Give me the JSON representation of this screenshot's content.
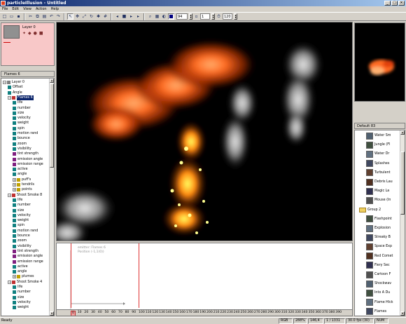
{
  "window": {
    "title": "particleIllusion - Untitled",
    "buttons": [
      "_",
      "□",
      "×"
    ]
  },
  "menu": [
    "File",
    "Edit",
    "View",
    "Action",
    "Help"
  ],
  "toolbar": {
    "icons": [
      "new-icon",
      "open-icon",
      "save-icon",
      "cut-icon",
      "copy-icon",
      "paste-icon",
      "undo-icon",
      "redo-icon",
      "select-icon",
      "move-icon",
      "scale-icon",
      "rotate-icon",
      "emitter-icon",
      "grid-icon",
      "rewind-icon",
      "stop-icon",
      "play-icon",
      "forward-icon",
      "zoom-icon",
      "render-icon",
      "alpha-icon",
      "bg-color-icon"
    ],
    "zoom_value": "94",
    "frame_value": "1",
    "fps_value": "120"
  },
  "layers": {
    "name": "Layer 0",
    "icons": [
      "visible-icon",
      "lock-icon",
      "solo-icon",
      "record-icon"
    ]
  },
  "hierarchy": {
    "title": "Flames 6",
    "nodes": [
      {
        "label": "Layer 0",
        "level": 0,
        "exp": "−",
        "icon": "layer"
      },
      {
        "label": "Offset",
        "level": 1,
        "icon": "prop"
      },
      {
        "label": "Angle",
        "level": 1,
        "icon": "prop"
      },
      {
        "label": "Flames 6",
        "level": 1,
        "exp": "−",
        "icon": "emitter",
        "selected": true
      },
      {
        "label": "life",
        "level": 2,
        "icon": "prop"
      },
      {
        "label": "number",
        "level": 2,
        "icon": "prop"
      },
      {
        "label": "size",
        "level": 2,
        "icon": "prop"
      },
      {
        "label": "velocity",
        "level": 2,
        "icon": "prop"
      },
      {
        "label": "weight",
        "level": 2,
        "icon": "prop"
      },
      {
        "label": "spin",
        "level": 2,
        "icon": "prop"
      },
      {
        "label": "motion rand",
        "level": 2,
        "icon": "prop"
      },
      {
        "label": "bounce",
        "level": 2,
        "icon": "prop"
      },
      {
        "label": "zoom",
        "level": 2,
        "icon": "prop"
      },
      {
        "label": "visibility",
        "level": 2,
        "icon": "prop"
      },
      {
        "label": "tint strength",
        "level": 2,
        "icon": "prop2"
      },
      {
        "label": "emission angle",
        "level": 2,
        "icon": "prop2"
      },
      {
        "label": "emission range",
        "level": 2,
        "icon": "prop2"
      },
      {
        "label": "active",
        "level": 2,
        "icon": "prop"
      },
      {
        "label": "angle",
        "level": 2,
        "icon": "prop"
      },
      {
        "label": "puff's",
        "level": 2,
        "exp": "+",
        "icon": "particle"
      },
      {
        "label": "tendrils",
        "level": 2,
        "exp": "+",
        "icon": "particle"
      },
      {
        "label": "points",
        "level": 2,
        "exp": "+",
        "icon": "particle"
      },
      {
        "label": "Shoot Smoke 8",
        "level": 1,
        "exp": "−",
        "icon": "emitter"
      },
      {
        "label": "life",
        "level": 2,
        "icon": "prop"
      },
      {
        "label": "number",
        "level": 2,
        "icon": "prop"
      },
      {
        "label": "size",
        "level": 2,
        "icon": "prop"
      },
      {
        "label": "velocity",
        "level": 2,
        "icon": "prop"
      },
      {
        "label": "weight",
        "level": 2,
        "icon": "prop"
      },
      {
        "label": "spin",
        "level": 2,
        "icon": "prop"
      },
      {
        "label": "motion rand",
        "level": 2,
        "icon": "prop"
      },
      {
        "label": "bounce",
        "level": 2,
        "icon": "prop"
      },
      {
        "label": "zoom",
        "level": 2,
        "icon": "prop"
      },
      {
        "label": "visibility",
        "level": 2,
        "icon": "prop"
      },
      {
        "label": "tint strength",
        "level": 2,
        "icon": "prop2"
      },
      {
        "label": "emission angle",
        "level": 2,
        "icon": "prop2"
      },
      {
        "label": "emission range",
        "level": 2,
        "icon": "prop2"
      },
      {
        "label": "active",
        "level": 2,
        "icon": "prop"
      },
      {
        "label": "angle",
        "level": 2,
        "icon": "prop"
      },
      {
        "label": "plumes",
        "level": 2,
        "exp": "+",
        "icon": "particle"
      },
      {
        "label": "Shoot Smoke 4",
        "level": 1,
        "exp": "−",
        "icon": "emitter"
      },
      {
        "label": "life",
        "level": 2,
        "icon": "prop"
      },
      {
        "label": "number",
        "level": 2,
        "icon": "prop"
      },
      {
        "label": "size",
        "level": 2,
        "icon": "prop"
      },
      {
        "label": "velocity",
        "level": 2,
        "icon": "prop"
      },
      {
        "label": "weight",
        "level": 2,
        "icon": "prop"
      }
    ]
  },
  "library": {
    "title": "Default 83",
    "items": [
      {
        "label": "Water Sm",
        "folder": false
      },
      {
        "label": "Jungle (Fl",
        "folder": false
      },
      {
        "label": "Water Dr",
        "folder": false
      },
      {
        "label": "Splashes",
        "folder": false
      },
      {
        "label": "Turbulent",
        "folder": false
      },
      {
        "label": "Debris Lau",
        "folder": false
      },
      {
        "label": "Magic La",
        "folder": false
      },
      {
        "label": "Mouse (In",
        "folder": false
      },
      {
        "label": "Group 2",
        "folder": true
      },
      {
        "label": "Flashpoint",
        "folder": false
      },
      {
        "label": "Explosion",
        "folder": false
      },
      {
        "label": "Streaky B",
        "folder": false
      },
      {
        "label": "Space Exp",
        "folder": false
      },
      {
        "label": "Red Comet",
        "folder": false
      },
      {
        "label": "Fiery Sec",
        "folder": false
      },
      {
        "label": "Cartoon F",
        "folder": false
      },
      {
        "label": "Shockwav",
        "folder": false
      },
      {
        "label": "Into A Du",
        "folder": false
      },
      {
        "label": "Flame Hlck",
        "folder": false
      },
      {
        "label": "Flames",
        "folder": false
      }
    ]
  },
  "timeline": {
    "lines": [
      "emitter: Flames 6",
      "Position (-1,1(0))"
    ],
    "ticks": [
      "0",
      "10",
      "20",
      "30",
      "40",
      "50",
      "60",
      "70",
      "80",
      "90",
      "100",
      "110",
      "120",
      "130",
      "140",
      "150",
      "160",
      "170",
      "180",
      "190",
      "200",
      "210",
      "220",
      "230",
      "240",
      "250",
      "260",
      "270",
      "280",
      "290",
      "300",
      "310",
      "320",
      "330",
      "340",
      "350",
      "360",
      "370",
      "380",
      "390"
    ]
  },
  "status": {
    "ready": "Ready",
    "cells": [
      "RGB",
      "288%",
      "146,4",
      "1 / 1331",
      "30.0 fps (30)",
      "NUM"
    ]
  }
}
